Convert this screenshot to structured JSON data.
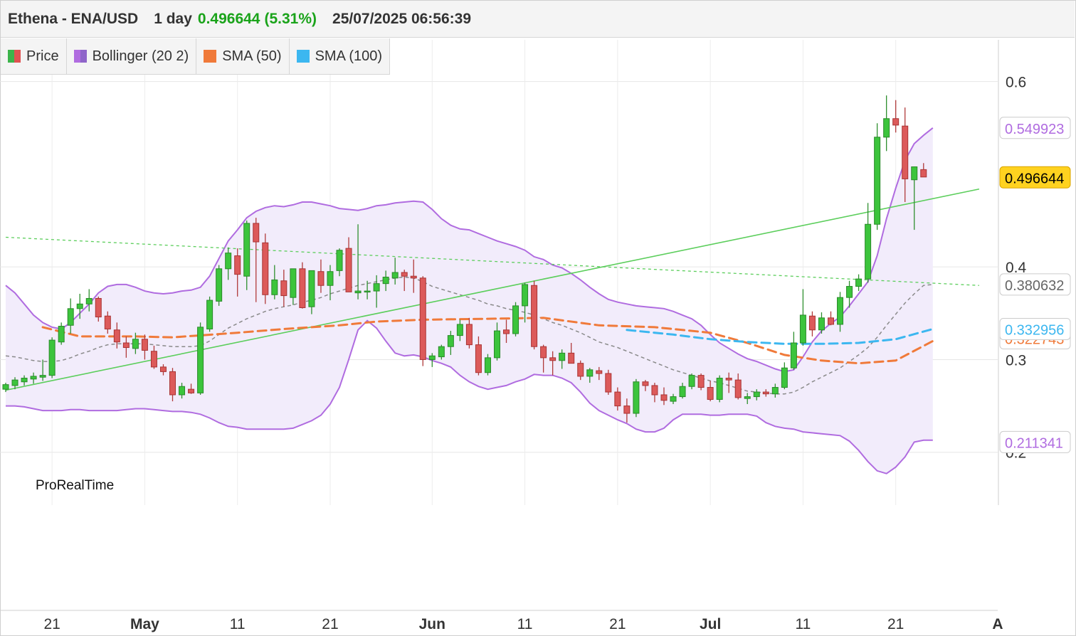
{
  "header": {
    "symbol": "Ethena - ENA/USD",
    "interval": "1 day",
    "last_price": "0.496644",
    "change_pct": "(5.31%)",
    "datetime": "25/07/2025 06:56:39"
  },
  "legend": [
    {
      "label": "Price",
      "color": "#3cb44b",
      "color2": "#e05252"
    },
    {
      "label": "Bollinger (20 2)",
      "color": "#b06ce0",
      "color2": "#8f65c9"
    },
    {
      "label": "SMA (50)",
      "color": "#f07a3a"
    },
    {
      "label": "SMA (100)",
      "color": "#3cb7f0"
    }
  ],
  "watermark": "ProRealTime",
  "chart_data": {
    "type": "candlestick",
    "y_ticks": [
      "0.6",
      "0.4",
      "0.3",
      "0.2"
    ],
    "y_tick_values": [
      0.6,
      0.4,
      0.3,
      0.2
    ],
    "ylim": [
      0.143,
      0.645
    ],
    "x_ticks": [
      {
        "label": "21",
        "date": "2025-04-21"
      },
      {
        "label": "May",
        "date": "2025-05-01"
      },
      {
        "label": "11",
        "date": "2025-05-11"
      },
      {
        "label": "21",
        "date": "2025-05-21"
      },
      {
        "label": "Jun",
        "date": "2025-06-01"
      },
      {
        "label": "11",
        "date": "2025-06-11"
      },
      {
        "label": "21",
        "date": "2025-06-21"
      },
      {
        "label": "Jul",
        "date": "2025-07-01"
      },
      {
        "label": "11",
        "date": "2025-07-11"
      },
      {
        "label": "21",
        "date": "2025-07-21"
      },
      {
        "label": "A",
        "date": "2025-08-01"
      }
    ],
    "x_start": "2025-04-16",
    "x_end": "2025-08-01",
    "start_date": "2025-04-16",
    "candles": [
      [
        0.268,
        0.275,
        0.265,
        0.273
      ],
      [
        0.272,
        0.281,
        0.268,
        0.278
      ],
      [
        0.276,
        0.283,
        0.272,
        0.28
      ],
      [
        0.279,
        0.286,
        0.274,
        0.282
      ],
      [
        0.281,
        0.3,
        0.277,
        0.283
      ],
      [
        0.283,
        0.324,
        0.28,
        0.321
      ],
      [
        0.319,
        0.34,
        0.316,
        0.336
      ],
      [
        0.337,
        0.366,
        0.328,
        0.355
      ],
      [
        0.355,
        0.371,
        0.344,
        0.36
      ],
      [
        0.36,
        0.376,
        0.352,
        0.366
      ],
      [
        0.366,
        0.368,
        0.341,
        0.346
      ],
      [
        0.347,
        0.352,
        0.328,
        0.333
      ],
      [
        0.332,
        0.34,
        0.312,
        0.319
      ],
      [
        0.318,
        0.325,
        0.302,
        0.313
      ],
      [
        0.312,
        0.329,
        0.306,
        0.322
      ],
      [
        0.322,
        0.327,
        0.3,
        0.31
      ],
      [
        0.309,
        0.315,
        0.29,
        0.292
      ],
      [
        0.292,
        0.295,
        0.283,
        0.287
      ],
      [
        0.287,
        0.291,
        0.255,
        0.262
      ],
      [
        0.262,
        0.275,
        0.258,
        0.271
      ],
      [
        0.268,
        0.274,
        0.263,
        0.264
      ],
      [
        0.264,
        0.34,
        0.262,
        0.335
      ],
      [
        0.333,
        0.368,
        0.33,
        0.364
      ],
      [
        0.363,
        0.402,
        0.358,
        0.398
      ],
      [
        0.398,
        0.421,
        0.386,
        0.415
      ],
      [
        0.412,
        0.42,
        0.368,
        0.392
      ],
      [
        0.39,
        0.45,
        0.375,
        0.447
      ],
      [
        0.447,
        0.453,
        0.362,
        0.427
      ],
      [
        0.426,
        0.436,
        0.36,
        0.37
      ],
      [
        0.37,
        0.402,
        0.365,
        0.386
      ],
      [
        0.385,
        0.397,
        0.357,
        0.369
      ],
      [
        0.367,
        0.395,
        0.359,
        0.398
      ],
      [
        0.398,
        0.405,
        0.355,
        0.356
      ],
      [
        0.357,
        0.394,
        0.349,
        0.396
      ],
      [
        0.395,
        0.408,
        0.372,
        0.38
      ],
      [
        0.38,
        0.402,
        0.364,
        0.395
      ],
      [
        0.396,
        0.42,
        0.39,
        0.418
      ],
      [
        0.42,
        0.432,
        0.38,
        0.373
      ],
      [
        0.372,
        0.446,
        0.365,
        0.374
      ],
      [
        0.374,
        0.385,
        0.365,
        0.374
      ],
      [
        0.374,
        0.391,
        0.356,
        0.382
      ],
      [
        0.382,
        0.396,
        0.374,
        0.389
      ],
      [
        0.388,
        0.41,
        0.381,
        0.394
      ],
      [
        0.394,
        0.397,
        0.374,
        0.39
      ],
      [
        0.39,
        0.408,
        0.372,
        0.388
      ],
      [
        0.388,
        0.39,
        0.293,
        0.3
      ],
      [
        0.3,
        0.307,
        0.292,
        0.304
      ],
      [
        0.303,
        0.316,
        0.3,
        0.314
      ],
      [
        0.314,
        0.331,
        0.305,
        0.326
      ],
      [
        0.326,
        0.343,
        0.32,
        0.338
      ],
      [
        0.338,
        0.345,
        0.312,
        0.316
      ],
      [
        0.316,
        0.325,
        0.283,
        0.286
      ],
      [
        0.286,
        0.306,
        0.283,
        0.302
      ],
      [
        0.302,
        0.34,
        0.299,
        0.331
      ],
      [
        0.332,
        0.343,
        0.318,
        0.328
      ],
      [
        0.328,
        0.362,
        0.325,
        0.358
      ],
      [
        0.358,
        0.383,
        0.34,
        0.381
      ],
      [
        0.38,
        0.385,
        0.311,
        0.314
      ],
      [
        0.314,
        0.316,
        0.286,
        0.302
      ],
      [
        0.302,
        0.309,
        0.283,
        0.299
      ],
      [
        0.299,
        0.311,
        0.29,
        0.307
      ],
      [
        0.307,
        0.318,
        0.296,
        0.296
      ],
      [
        0.296,
        0.299,
        0.278,
        0.282
      ],
      [
        0.282,
        0.291,
        0.275,
        0.289
      ],
      [
        0.288,
        0.292,
        0.278,
        0.285
      ],
      [
        0.285,
        0.289,
        0.262,
        0.265
      ],
      [
        0.265,
        0.27,
        0.245,
        0.25
      ],
      [
        0.25,
        0.258,
        0.232,
        0.242
      ],
      [
        0.242,
        0.279,
        0.238,
        0.276
      ],
      [
        0.276,
        0.278,
        0.266,
        0.272
      ],
      [
        0.272,
        0.275,
        0.254,
        0.262
      ],
      [
        0.262,
        0.27,
        0.251,
        0.256
      ],
      [
        0.255,
        0.263,
        0.252,
        0.26
      ],
      [
        0.26,
        0.275,
        0.258,
        0.271
      ],
      [
        0.271,
        0.285,
        0.268,
        0.283
      ],
      [
        0.283,
        0.285,
        0.267,
        0.27
      ],
      [
        0.27,
        0.277,
        0.255,
        0.257
      ],
      [
        0.257,
        0.283,
        0.254,
        0.28
      ],
      [
        0.28,
        0.286,
        0.264,
        0.278
      ],
      [
        0.278,
        0.285,
        0.257,
        0.259
      ],
      [
        0.258,
        0.264,
        0.252,
        0.26
      ],
      [
        0.26,
        0.268,
        0.256,
        0.265
      ],
      [
        0.265,
        0.268,
        0.26,
        0.263
      ],
      [
        0.263,
        0.274,
        0.259,
        0.27
      ],
      [
        0.27,
        0.297,
        0.268,
        0.291
      ],
      [
        0.291,
        0.33,
        0.289,
        0.318
      ],
      [
        0.318,
        0.376,
        0.315,
        0.348
      ],
      [
        0.347,
        0.352,
        0.325,
        0.332
      ],
      [
        0.332,
        0.351,
        0.328,
        0.345
      ],
      [
        0.345,
        0.352,
        0.337,
        0.338
      ],
      [
        0.338,
        0.373,
        0.33,
        0.367
      ],
      [
        0.367,
        0.385,
        0.356,
        0.379
      ],
      [
        0.379,
        0.392,
        0.374,
        0.387
      ],
      [
        0.387,
        0.469,
        0.383,
        0.446
      ],
      [
        0.446,
        0.555,
        0.44,
        0.54
      ],
      [
        0.54,
        0.585,
        0.525,
        0.56
      ],
      [
        0.56,
        0.58,
        0.545,
        0.553
      ],
      [
        0.552,
        0.572,
        0.47,
        0.495
      ],
      [
        0.494,
        0.508,
        0.44,
        0.508
      ],
      [
        0.505,
        0.512,
        0.498,
        0.497
      ]
    ],
    "bollinger_upper": [
      0.38,
      0.372,
      0.36,
      0.348,
      0.34,
      0.335,
      0.333,
      0.34,
      0.35,
      0.36,
      0.372,
      0.379,
      0.381,
      0.381,
      0.378,
      0.374,
      0.372,
      0.371,
      0.372,
      0.374,
      0.375,
      0.378,
      0.39,
      0.409,
      0.428,
      0.44,
      0.453,
      0.46,
      0.464,
      0.466,
      0.465,
      0.467,
      0.47,
      0.47,
      0.468,
      0.466,
      0.463,
      0.462,
      0.461,
      0.463,
      0.466,
      0.467,
      0.469,
      0.47,
      0.471,
      0.47,
      0.462,
      0.452,
      0.445,
      0.441,
      0.44,
      0.436,
      0.432,
      0.428,
      0.425,
      0.422,
      0.418,
      0.411,
      0.408,
      0.402,
      0.399,
      0.393,
      0.386,
      0.378,
      0.371,
      0.365,
      0.362,
      0.36,
      0.358,
      0.357,
      0.356,
      0.355,
      0.352,
      0.348,
      0.344,
      0.337,
      0.327,
      0.318,
      0.312,
      0.306,
      0.301,
      0.298,
      0.294,
      0.29,
      0.287,
      0.289,
      0.303,
      0.319,
      0.331,
      0.339,
      0.346,
      0.358,
      0.371,
      0.384,
      0.412,
      0.452,
      0.485,
      0.515,
      0.533,
      0.542,
      0.55
    ],
    "bollinger_middle": [
      0.304,
      0.303,
      0.301,
      0.299,
      0.298,
      0.298,
      0.299,
      0.302,
      0.306,
      0.309,
      0.313,
      0.316,
      0.317,
      0.317,
      0.317,
      0.317,
      0.316,
      0.315,
      0.314,
      0.314,
      0.314,
      0.315,
      0.32,
      0.327,
      0.334,
      0.339,
      0.344,
      0.348,
      0.352,
      0.355,
      0.357,
      0.359,
      0.362,
      0.364,
      0.367,
      0.371,
      0.374,
      0.377,
      0.38,
      0.382,
      0.384,
      0.386,
      0.388,
      0.389,
      0.388,
      0.384,
      0.379,
      0.376,
      0.373,
      0.37,
      0.367,
      0.364,
      0.36,
      0.358,
      0.355,
      0.353,
      0.351,
      0.348,
      0.344,
      0.34,
      0.337,
      0.333,
      0.329,
      0.324,
      0.319,
      0.316,
      0.313,
      0.309,
      0.305,
      0.301,
      0.297,
      0.293,
      0.289,
      0.286,
      0.283,
      0.28,
      0.277,
      0.275,
      0.272,
      0.269,
      0.266,
      0.265,
      0.264,
      0.263,
      0.263,
      0.265,
      0.27,
      0.276,
      0.281,
      0.286,
      0.291,
      0.298,
      0.305,
      0.313,
      0.324,
      0.337,
      0.349,
      0.361,
      0.371,
      0.38,
      0.381
    ],
    "bollinger_lower": [
      0.25,
      0.25,
      0.249,
      0.247,
      0.245,
      0.245,
      0.245,
      0.246,
      0.246,
      0.245,
      0.245,
      0.245,
      0.245,
      0.246,
      0.247,
      0.247,
      0.246,
      0.245,
      0.244,
      0.244,
      0.243,
      0.241,
      0.237,
      0.232,
      0.228,
      0.227,
      0.225,
      0.225,
      0.225,
      0.225,
      0.225,
      0.226,
      0.23,
      0.234,
      0.24,
      0.252,
      0.27,
      0.3,
      0.332,
      0.342,
      0.334,
      0.32,
      0.307,
      0.304,
      0.305,
      0.303,
      0.299,
      0.296,
      0.292,
      0.283,
      0.276,
      0.271,
      0.268,
      0.27,
      0.272,
      0.276,
      0.279,
      0.284,
      0.283,
      0.283,
      0.28,
      0.275,
      0.265,
      0.253,
      0.245,
      0.24,
      0.235,
      0.231,
      0.225,
      0.222,
      0.222,
      0.226,
      0.235,
      0.241,
      0.241,
      0.241,
      0.24,
      0.24,
      0.241,
      0.241,
      0.241,
      0.239,
      0.232,
      0.228,
      0.226,
      0.225,
      0.222,
      0.221,
      0.22,
      0.219,
      0.218,
      0.212,
      0.202,
      0.19,
      0.18,
      0.177,
      0.184,
      0.195,
      0.211,
      0.213,
      0.213
    ],
    "sma50": [
      [
        4,
        0.335
      ],
      [
        8,
        0.325
      ],
      [
        14,
        0.325
      ],
      [
        18,
        0.324
      ],
      [
        25,
        0.329
      ],
      [
        30,
        0.333
      ],
      [
        36,
        0.337
      ],
      [
        40,
        0.341
      ],
      [
        45,
        0.343
      ],
      [
        52,
        0.344
      ],
      [
        58,
        0.345
      ],
      [
        64,
        0.337
      ],
      [
        70,
        0.335
      ],
      [
        76,
        0.329
      ],
      [
        80,
        0.318
      ],
      [
        84,
        0.305
      ],
      [
        88,
        0.299
      ],
      [
        92,
        0.296
      ],
      [
        96,
        0.299
      ],
      [
        100,
        0.32
      ]
    ],
    "sma100": [
      [
        67,
        0.332
      ],
      [
        72,
        0.327
      ],
      [
        76,
        0.322
      ],
      [
        80,
        0.319
      ],
      [
        84,
        0.317
      ],
      [
        88,
        0.317
      ],
      [
        92,
        0.318
      ],
      [
        96,
        0.322
      ],
      [
        100,
        0.333
      ]
    ],
    "trend_solid": {
      "from": [
        0,
        0.267
      ],
      "to": [
        105,
        0.484
      ]
    },
    "trend_dashed": {
      "from": [
        0,
        0.432
      ],
      "to": [
        105,
        0.38
      ]
    },
    "last_labels": [
      {
        "text": "0.549923",
        "value": 0.55,
        "color": "#b06ce0",
        "bg": "#ffffff",
        "border": "#cccccc"
      },
      {
        "text": "0.496644",
        "value": 0.496644,
        "color": "#000000",
        "bg": "#ffd21f",
        "border": "#d9a400"
      },
      {
        "text": "0.380632",
        "value": 0.381,
        "color": "#666666",
        "bg": "#ffffff",
        "border": "#cccccc"
      },
      {
        "text": "0.322743",
        "value": 0.323,
        "color": "#f07a3a",
        "bg": "#ffffff",
        "border": "#cccccc"
      },
      {
        "text": "0.332956",
        "value": 0.333,
        "color": "#3cb7f0",
        "bg": "#ffffff",
        "border": "#cccccc"
      },
      {
        "text": "0.211341",
        "value": 0.211,
        "color": "#b06ce0",
        "bg": "#ffffff",
        "border": "#cccccc"
      }
    ]
  }
}
